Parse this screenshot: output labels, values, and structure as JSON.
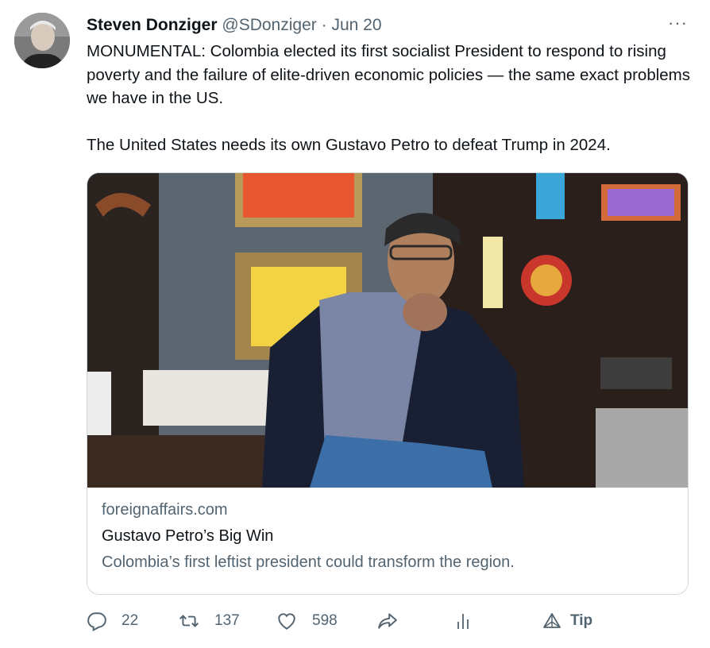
{
  "tweet": {
    "author_name": "Steven Donziger",
    "author_handle": "@SDonziger",
    "separator": "·",
    "date": "Jun 20",
    "more_label": "···",
    "paragraphs": [
      "MONUMENTAL: Colombia elected its first socialist President to respond to rising poverty and the failure of elite-driven economic policies  — the same exact problems we have in the US.",
      "The United States needs its own Gustavo Petro to defeat Trump in 2024."
    ]
  },
  "card": {
    "domain": "foreignaffairs.com",
    "title": "Gustavo Petro’s Big Win",
    "description": "Colombia’s first leftist president could transform the region."
  },
  "actions": {
    "reply": {
      "icon": "reply-icon",
      "count": "22"
    },
    "retweet": {
      "icon": "retweet-icon",
      "count": "137"
    },
    "like": {
      "icon": "heart-icon",
      "count": "598"
    },
    "share": {
      "icon": "share-icon"
    },
    "analytics": {
      "icon": "analytics-icon"
    },
    "tip": {
      "icon": "tip-icon",
      "label": "Tip"
    }
  },
  "colors": {
    "text_primary": "#0f1419",
    "text_secondary": "#536471",
    "border": "#cfd9de"
  }
}
